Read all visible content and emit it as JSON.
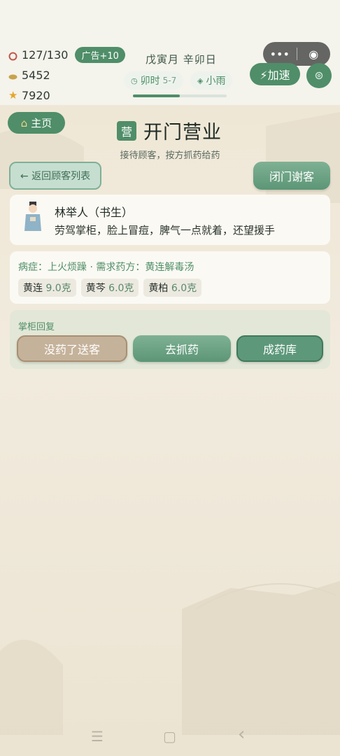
{
  "status": {
    "stamina": "127/130",
    "ad_badge": "广告+10",
    "coins": "5452",
    "stars": "7920",
    "date": "戊寅月 辛卯日",
    "time_pill": "卯时",
    "time_range": "5-7",
    "weather": "小雨",
    "day_progress": 0.5,
    "speed_label": "⚡加速"
  },
  "capsule": {
    "more": "•••",
    "close": "◉"
  },
  "header": {
    "home_label": "主页",
    "seal": "营",
    "title": "开门营业",
    "subtitle": "接待顾客，按方抓药给药",
    "back_label": "← 返回顾客列表",
    "close_label": "闭门谢客"
  },
  "customer": {
    "name": "林举人（书生）",
    "line": "劳驾掌柜，脸上冒痘，脾气一点就着，还望援手"
  },
  "symptom": {
    "text": "病症：上火烦躁 · 需求药方：黄连解毒汤",
    "herbs": [
      {
        "name": "黄连",
        "amount": "9.0克"
      },
      {
        "name": "黄芩",
        "amount": "6.0克"
      },
      {
        "name": "黄柏",
        "amount": "6.0克"
      }
    ]
  },
  "reply": {
    "label": "掌柜回复",
    "no_medicine": "没药了送客",
    "fetch": "去抓药",
    "store": "成药库"
  },
  "nav": {
    "menu": "☰",
    "home": "▢",
    "back": "‹"
  },
  "colors": {
    "accent": "#4f8e68",
    "bg": "#efe8d8"
  }
}
